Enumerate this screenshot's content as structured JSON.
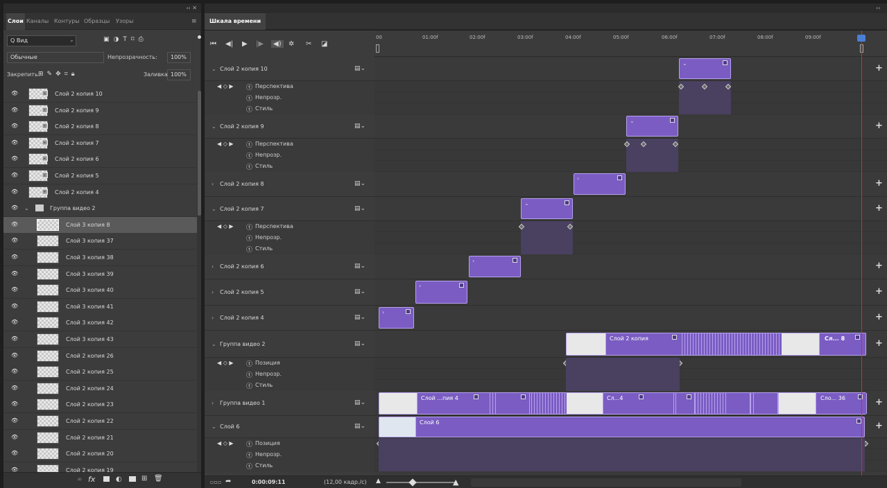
{
  "left_panel": {
    "collapse_arrows": "‹‹ ✕",
    "tabs": [
      "Слои",
      "Каналы",
      "Контуры",
      "Образцы",
      "Узоры"
    ],
    "search_placeholder": "Q Вид",
    "blend_mode": "Обычные",
    "opacity_label": "Непрозрачность:",
    "opacity_value": "100%",
    "lock_label": "Закрепить:",
    "fill_label": "Заливка:",
    "fill_value": "100%",
    "layers": [
      {
        "name": "Слой 2 копия 10",
        "kind": "layer"
      },
      {
        "name": "Слой 2 копия 9",
        "kind": "layer"
      },
      {
        "name": "Слой 2 копия 8",
        "kind": "layer"
      },
      {
        "name": "Слой 2 копия 7",
        "kind": "layer"
      },
      {
        "name": "Слой 2 копия 6",
        "kind": "layer"
      },
      {
        "name": "Слой 2 копия 5",
        "kind": "layer"
      },
      {
        "name": "Слой 2 копия 4",
        "kind": "layer"
      },
      {
        "name": "Группа видео 2",
        "kind": "group"
      },
      {
        "name": "Слой 3 копия 8",
        "kind": "child",
        "selected": true
      },
      {
        "name": "Слой 3 копия 37",
        "kind": "child"
      },
      {
        "name": "Слой 3 копия 38",
        "kind": "child"
      },
      {
        "name": "Слой 3 копия 39",
        "kind": "child"
      },
      {
        "name": "Слой 3 копия 40",
        "kind": "child"
      },
      {
        "name": "Слой 3 копия 41",
        "kind": "child"
      },
      {
        "name": "Слой 3 копия 42",
        "kind": "child"
      },
      {
        "name": "Слой 3 копия 43",
        "kind": "child"
      },
      {
        "name": "Слой 2 копия 26",
        "kind": "child"
      },
      {
        "name": "Слой 2 копия 25",
        "kind": "child"
      },
      {
        "name": "Слой 2 копия 24",
        "kind": "child"
      },
      {
        "name": "Слой 2 копия 23",
        "kind": "child"
      },
      {
        "name": "Слой 2 копия 22",
        "kind": "child"
      },
      {
        "name": "Слой 2 копия 21",
        "kind": "child"
      },
      {
        "name": "Слой 2 копия 20",
        "kind": "child"
      },
      {
        "name": "Слой 2 копия 19",
        "kind": "child"
      }
    ],
    "bottom_icons": [
      "link-icon",
      "fx-icon",
      "mask-icon",
      "adjustment-icon",
      "folder-icon",
      "new-layer-icon",
      "trash-icon"
    ]
  },
  "timeline": {
    "title": "Шкала времени",
    "ruler_ticks": [
      "00",
      "01:00f",
      "02:00f",
      "03:00f",
      "04:00f",
      "05:00f",
      "06:00f",
      "07:00f",
      "08:00f",
      "09:00f"
    ],
    "tracks": [
      {
        "name": "Слой 2 копия 10",
        "expanded": true,
        "props": [
          "Перспектива",
          "Непрозр.",
          "Стиль"
        ]
      },
      {
        "name": "Слой 2 копия 9",
        "expanded": true,
        "props": [
          "Перспектива",
          "Непрозр.",
          "Стиль"
        ]
      },
      {
        "name": "Слой 2 копия 8",
        "expanded": false,
        "props": []
      },
      {
        "name": "Слой 2 копия 7",
        "expanded": true,
        "props": [
          "Перспектива",
          "Непрозр.",
          "Стиль"
        ]
      },
      {
        "name": "Слой 2 копия 6",
        "expanded": false,
        "props": []
      },
      {
        "name": "Слой 2 копия 5",
        "expanded": false,
        "props": []
      },
      {
        "name": "Слой 2 копия 4",
        "expanded": false,
        "props": []
      },
      {
        "name": "Группа видео 2",
        "expanded": true,
        "props": [
          "Позиция",
          "Непрозр.",
          "Стиль"
        ]
      },
      {
        "name": "Группа видео 1",
        "expanded": false,
        "props": []
      },
      {
        "name": "Слой 6",
        "expanded": true,
        "props": [
          "Позиция",
          "Непрозр.",
          "Стиль"
        ]
      }
    ],
    "clip_labels": {
      "g2_a": "Слой 2 копия",
      "g2_b": "Сл... 8",
      "g1_a": "Слой ...пия 4",
      "g1_b": "Сл...4",
      "g1_c": "Сло... 36",
      "s6": "Слой 6"
    },
    "timecode": "0:00:09:11",
    "framerate": "(12,00 кадр./с)",
    "colors": {
      "clip": "#7a5cc2",
      "playhead": "#e22222",
      "accent": "#4a7fd6"
    }
  }
}
